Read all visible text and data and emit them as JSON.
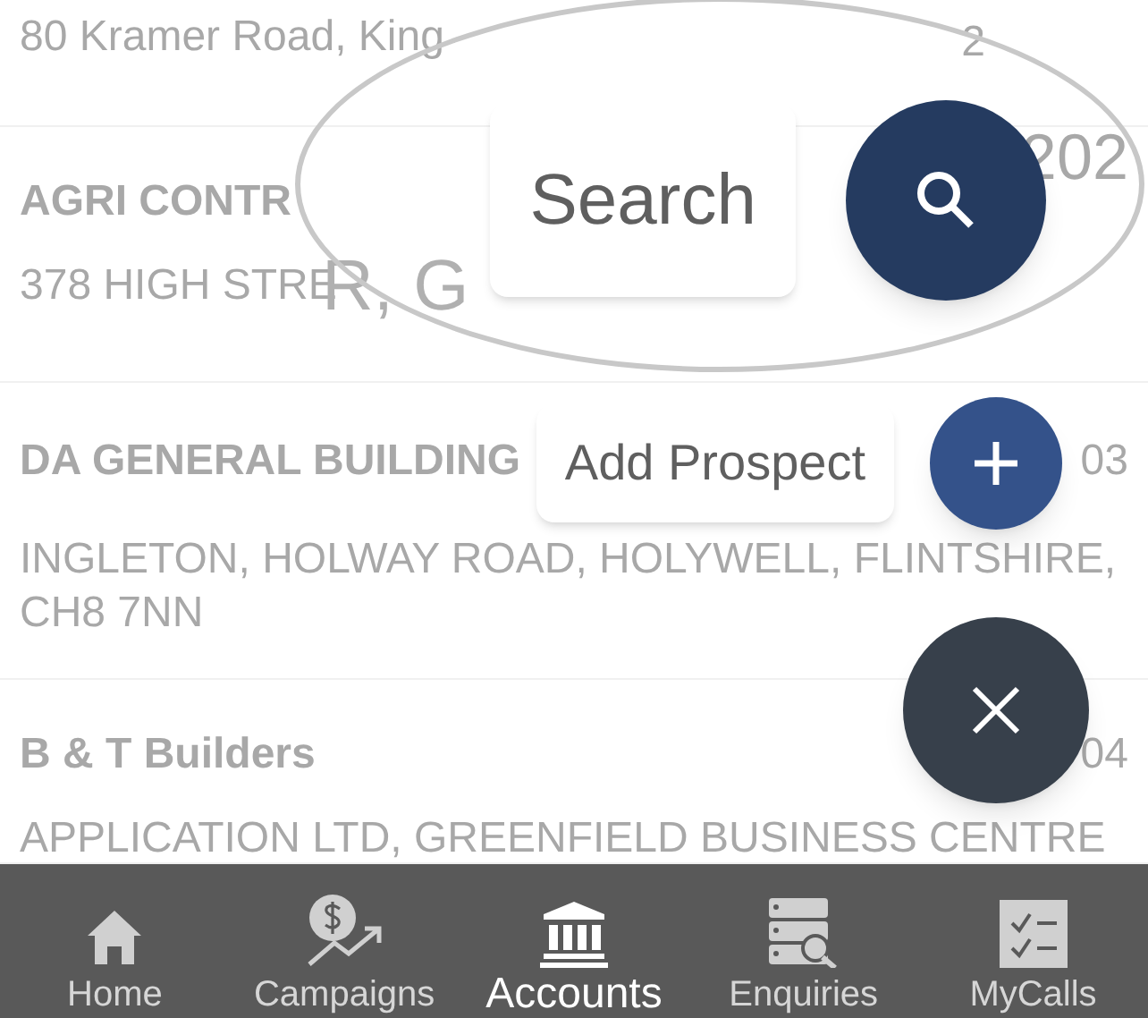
{
  "accounts": [
    {
      "address": "80 Kramer Road, King",
      "code": "2"
    },
    {
      "name": "AGRI CONTR",
      "address": "378 HIGH STRE",
      "code": "202"
    },
    {
      "name": "DA GENERAL BUILDING",
      "address": "INGLETON, HOLWAY ROAD, HOLYWELL, FLINTSHIRE, CH8 7NN",
      "code": "03"
    },
    {
      "name": "B & T Builders",
      "address": "APPLICATION LTD, GREENFIELD BUSINESS CENTRE",
      "code": "04"
    }
  ],
  "magnified_text": [
    "R, G"
  ],
  "speed_dial": {
    "actions": [
      {
        "kind": "search",
        "label": "Search",
        "highlighted": true
      },
      {
        "kind": "add",
        "label": "Add Prospect",
        "highlighted": false
      }
    ],
    "open": true
  },
  "bottom_nav": [
    {
      "kind": "home",
      "label": "Home",
      "selected": false
    },
    {
      "kind": "campaigns",
      "label": "Campaigns",
      "selected": false
    },
    {
      "kind": "accounts",
      "label": "Accounts",
      "selected": true
    },
    {
      "kind": "enquiries",
      "label": "Enquiries",
      "selected": false
    },
    {
      "kind": "mycalls",
      "label": "MyCalls",
      "selected": false
    }
  ]
}
